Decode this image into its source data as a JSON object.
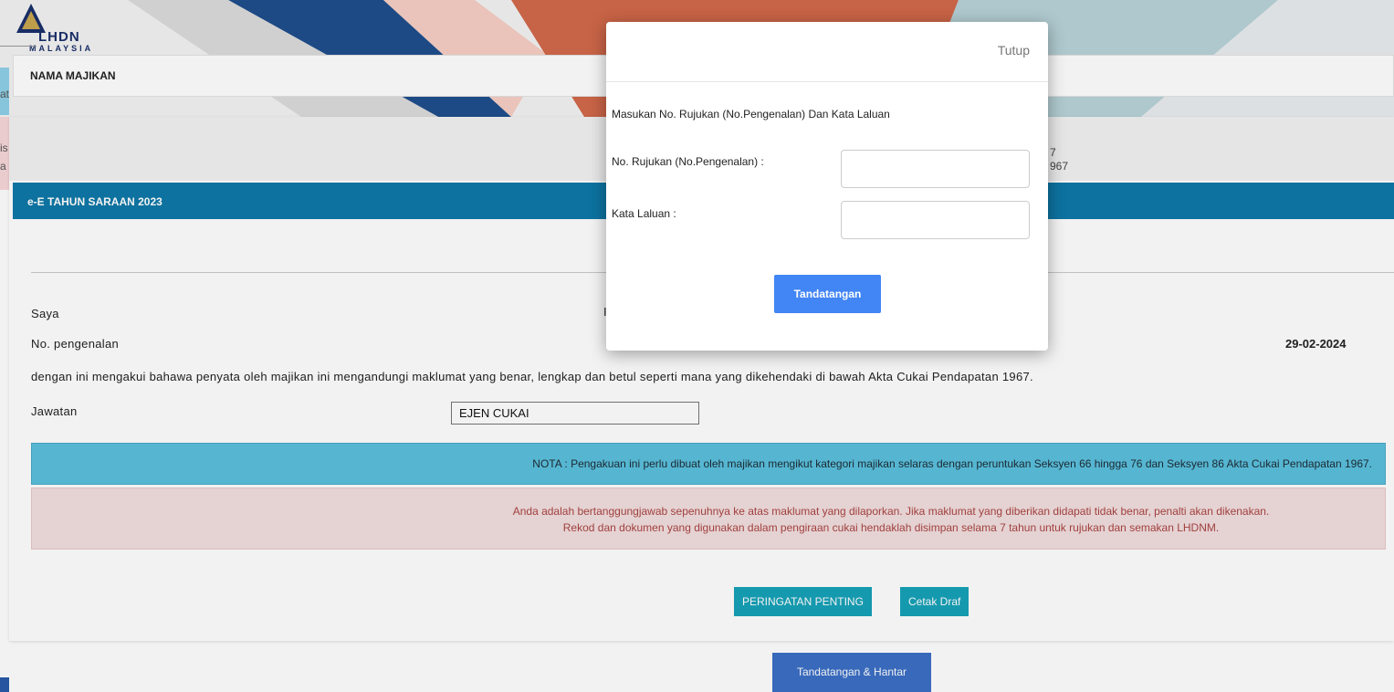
{
  "logo": {
    "line1": "LHDN",
    "line2": "MALAYSIA"
  },
  "header": {
    "employer_label": "NAMA MAJIKAN"
  },
  "left_fragments": [
    "at",
    "is",
    "a"
  ],
  "right_fragments": [
    "7",
    "967"
  ],
  "section": {
    "title": "e-E TAHUN SARAAN 2023"
  },
  "form": {
    "saya_label": "Saya",
    "saya_value_fragment": "I",
    "no_pengenalan_label": "No. pengenalan",
    "date": "29-02-2024",
    "declaration": "dengan ini mengakui bahawa penyata oleh majikan ini mengandungi maklumat yang benar, lengkap dan betul seperti mana yang dikehendaki di bawah Akta Cukai Pendapatan 1967.",
    "jawatan_label": "Jawatan",
    "jawatan_value": "EJEN CUKAI"
  },
  "nota": "NOTA : Pengakuan ini perlu dibuat oleh majikan mengikut kategori majikan selaras dengan peruntukan Seksyen 66 hingga 76 dan Seksyen 86 Akta Cukai Pendapatan 1967.",
  "alert": {
    "line1": "Anda adalah bertanggungjawab sepenuhnya ke atas maklumat yang dilaporkan. Jika maklumat yang diberikan didapati tidak benar, penalti akan dikenakan.",
    "line2": "Rekod dan dokumen yang digunakan dalam pengiraan cukai hendaklah disimpan selama 7 tahun untuk rujukan dan semakan LHDNM."
  },
  "buttons": {
    "peringatan": "PERINGATAN PENTING",
    "cetak": "Cetak Draf",
    "submit": "Tandatangan & Hantar"
  },
  "modal": {
    "close": "Tutup",
    "instruction": "Masukan No. Rujukan (No.Pengenalan) Dan Kata Laluan",
    "rujukan_label": "No. Rujukan (No.Pengenalan) :",
    "rujukan_value": "",
    "password_label": "Kata Laluan :",
    "password_value": "",
    "sign_button": "Tandatangan"
  },
  "colors": {
    "primary_blue": "#0e79a8",
    "teal": "#17a2b8",
    "info": "#5bc0de",
    "danger_bg": "#f2dede",
    "sign_button": "#4285f4",
    "submit_button": "#3b6fc6"
  }
}
